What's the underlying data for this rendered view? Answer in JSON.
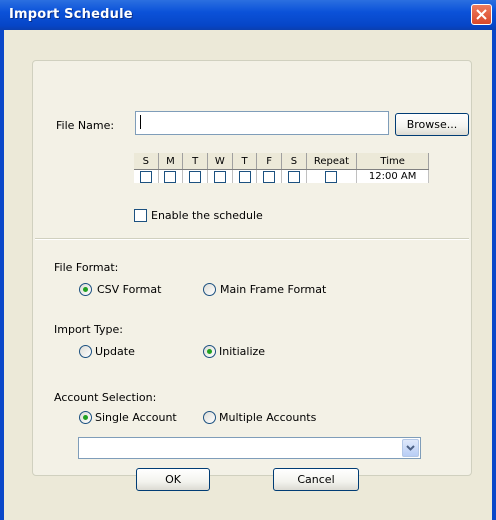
{
  "window": {
    "title": "Import Schedule"
  },
  "file": {
    "label": "File Name:",
    "value": "",
    "browse_label": "Browse..."
  },
  "schedule": {
    "columns": [
      "S",
      "M",
      "T",
      "W",
      "T",
      "F",
      "S",
      "Repeat",
      "Time"
    ],
    "time_value": "12:00 AM",
    "enable_label": "Enable the schedule"
  },
  "file_format": {
    "label": "File Format:",
    "options": [
      "CSV Format",
      "Main Frame Format"
    ],
    "selected": "CSV Format"
  },
  "import_type": {
    "label": "Import Type:",
    "options": [
      "Update",
      "Initialize"
    ],
    "selected": "Initialize"
  },
  "account_selection": {
    "label": "Account Selection:",
    "options": [
      "Single Account",
      "Multiple Accounts"
    ],
    "selected": "Single Account",
    "combo_value": ""
  },
  "buttons": {
    "ok": "OK",
    "cancel": "Cancel"
  },
  "colors": {
    "title_bar": "#0a52d9",
    "client_bg": "#ece9d8",
    "radio_dot": "#21a121",
    "close_button": "#e0583a"
  }
}
